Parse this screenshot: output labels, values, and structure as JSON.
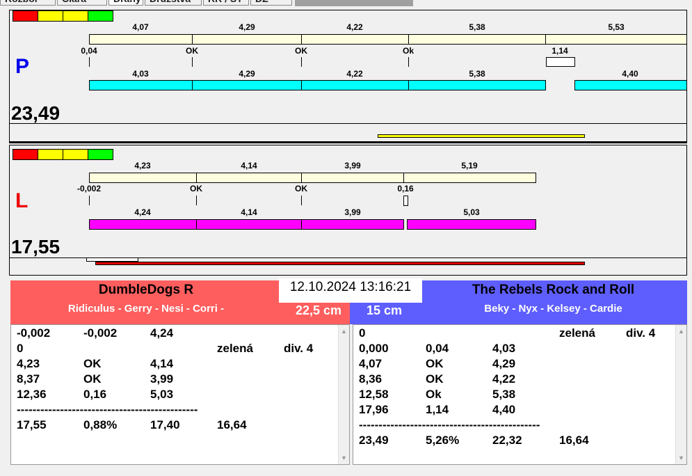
{
  "tabs": [
    "Rozbor",
    "Čiara",
    "Dráhy",
    "Družstvá",
    "RR / ST",
    "DZ"
  ],
  "colors": {
    "red": "#ff0000",
    "yellow": "#ffff00",
    "green": "#00ff00",
    "cream": "#ffffe0",
    "cyan": "#00ffff",
    "magenta": "#ff00ff",
    "team_left": "#ff5e5e",
    "team_right": "#5e5eff"
  },
  "lane_p": {
    "letter": "P",
    "score": "23,49",
    "top_labels": [
      "4,07",
      "4,29",
      "4,22",
      "5,38",
      "5,53"
    ],
    "mid_labels": [
      "0,04",
      "OK",
      "OK",
      "Ok",
      "1,14"
    ],
    "bot_labels": [
      "4,03",
      "4,29",
      "4,22",
      "5,38",
      "4,40"
    ]
  },
  "lane_l": {
    "letter": "L",
    "score": "17,55",
    "top_labels": [
      "4,23",
      "4,14",
      "3,99",
      "5,19"
    ],
    "mid_labels": [
      "-0,002",
      "OK",
      "OK",
      "0,16"
    ],
    "bot_labels": [
      "4,24",
      "4,14",
      "3,99",
      "5,03"
    ]
  },
  "datetime": "12.10.2024 13:16:21",
  "left_team": {
    "name": "DumbleDogs R",
    "dogs": "Ridiculus - Gerry - Nesi - Corri -",
    "height": "22,5 cm",
    "rows": [
      [
        "-0,002",
        "-0,002",
        "4,24",
        "",
        ""
      ],
      [
        "0",
        "",
        "",
        "zelená",
        "div. 4"
      ],
      [
        "4,23",
        "OK",
        "4,14",
        "",
        ""
      ],
      [
        "8,37",
        "OK",
        "3,99",
        "",
        ""
      ],
      [
        "12,36",
        "0,16",
        "5,03",
        "",
        ""
      ],
      [
        "----------------------------------------------",
        "",
        "",
        "",
        ""
      ],
      [
        "17,55",
        "0,88%",
        "17,40",
        "16,64",
        ""
      ]
    ]
  },
  "right_team": {
    "name": "The Rebels Rock and Roll",
    "dogs": "Beky - Nyx - Kelsey - Cardie",
    "height": "15 cm",
    "rows": [
      [
        "0",
        "",
        "",
        "zelená",
        "div. 4"
      ],
      [
        "0,000",
        "0,04",
        "4,03",
        "",
        ""
      ],
      [
        "4,07",
        "OK",
        "4,29",
        "",
        ""
      ],
      [
        "8,36",
        "OK",
        "4,22",
        "",
        ""
      ],
      [
        "12,58",
        "Ok",
        "5,38",
        "",
        ""
      ],
      [
        "17,96",
        "1,14",
        "4,40",
        "",
        ""
      ],
      [
        "----------------------------------------------",
        "",
        "",
        "",
        ""
      ],
      [
        "23,49",
        "5,26%",
        "22,32",
        "16,64",
        ""
      ]
    ]
  }
}
